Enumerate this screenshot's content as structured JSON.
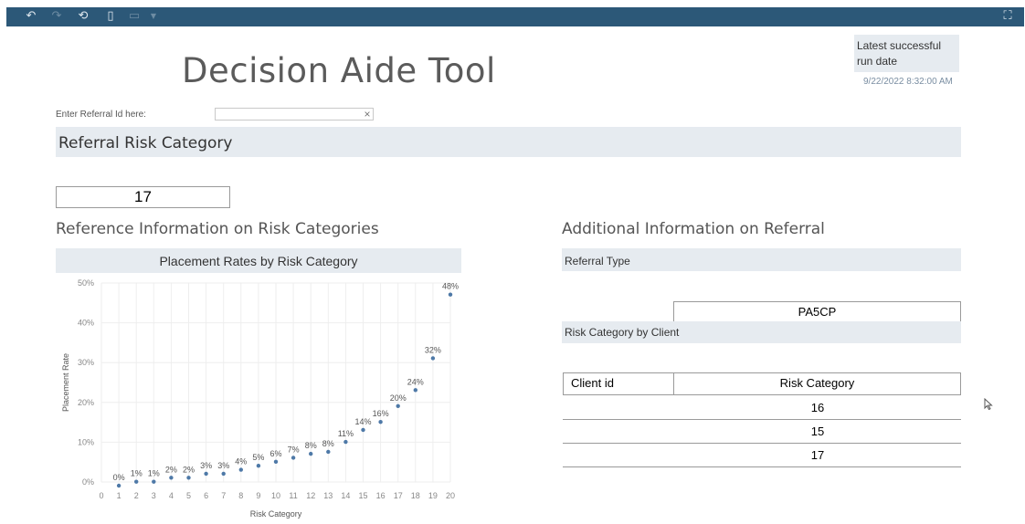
{
  "toolbar": {
    "icons": [
      "undo-icon",
      "redo-icon",
      "revert-icon",
      "device-icon",
      "share-icon",
      "dropdown-icon",
      "fullscreen-icon"
    ],
    "bg_color": "#2c5878"
  },
  "app_title": "Decision Aide Tool",
  "run_info": {
    "label": "Latest successful run date",
    "date": "9/22/2022 8:32:00 AM"
  },
  "referral_input": {
    "label": "Enter Referral Id here:",
    "value": "",
    "clear_icon": "×"
  },
  "referral_risk": {
    "heading": "Referral Risk Category",
    "value": "17"
  },
  "reference_section": {
    "heading": "Reference Information on Risk Categories"
  },
  "additional_section": {
    "heading": "Additional Information on Referral",
    "referral_type_label": "Referral Type",
    "referral_type_value": "PA5CP",
    "risk_by_client_label": "Risk Category by Client",
    "table": {
      "headers": [
        "Client id",
        "Risk Category"
      ],
      "rows": [
        {
          "client_id": "",
          "risk_category": "16"
        },
        {
          "client_id": "",
          "risk_category": "15"
        },
        {
          "client_id": "",
          "risk_category": "17"
        }
      ]
    }
  },
  "chart_data": {
    "type": "scatter",
    "title": "Placement Rates by Risk Category",
    "xlabel": "Risk Category",
    "ylabel": "Placement Rate",
    "xlim": [
      0,
      20
    ],
    "ylim": [
      0,
      50
    ],
    "x_ticks": [
      "0",
      "1",
      "2",
      "3",
      "4",
      "5",
      "6",
      "7",
      "8",
      "9",
      "10",
      "11",
      "12",
      "13",
      "14",
      "15",
      "16",
      "17",
      "18",
      "19",
      "20"
    ],
    "y_ticks": [
      "0%",
      "10%",
      "20%",
      "30%",
      "40%",
      "50%"
    ],
    "grid": true,
    "marker_color": "#4e79a7",
    "points": [
      {
        "x": 1,
        "y": 0,
        "label": "0%"
      },
      {
        "x": 2,
        "y": 1,
        "label": "1%"
      },
      {
        "x": 3,
        "y": 1,
        "label": "1%"
      },
      {
        "x": 4,
        "y": 2,
        "label": "2%"
      },
      {
        "x": 5,
        "y": 2,
        "label": "2%"
      },
      {
        "x": 6,
        "y": 3,
        "label": "3%"
      },
      {
        "x": 7,
        "y": 3,
        "label": "3%"
      },
      {
        "x": 8,
        "y": 4,
        "label": "4%"
      },
      {
        "x": 9,
        "y": 5,
        "label": "5%"
      },
      {
        "x": 10,
        "y": 6,
        "label": "6%"
      },
      {
        "x": 11,
        "y": 7,
        "label": "7%"
      },
      {
        "x": 12,
        "y": 8,
        "label": "8%"
      },
      {
        "x": 13,
        "y": 8.5,
        "label": "8%"
      },
      {
        "x": 14,
        "y": 11,
        "label": "11%"
      },
      {
        "x": 15,
        "y": 14,
        "label": "14%"
      },
      {
        "x": 16,
        "y": 16,
        "label": "16%"
      },
      {
        "x": 17,
        "y": 20,
        "label": "20%"
      },
      {
        "x": 18,
        "y": 24,
        "label": "24%"
      },
      {
        "x": 19,
        "y": 32,
        "label": "32%"
      },
      {
        "x": 20,
        "y": 48,
        "label": "48%"
      }
    ]
  }
}
